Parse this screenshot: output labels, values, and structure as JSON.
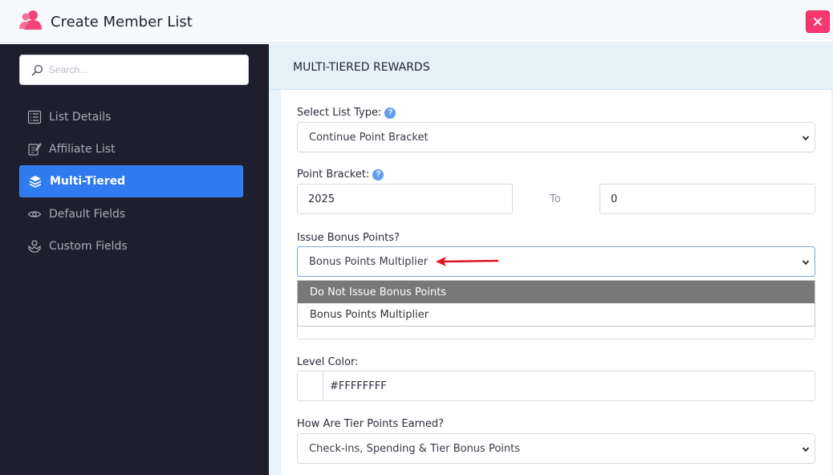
{
  "header": {
    "title": "Create Member List",
    "icon": "users-icon",
    "close_icon": "close-icon",
    "close_color": "#f7386e"
  },
  "sidebar": {
    "search_placeholder": "Search...",
    "items": [
      {
        "label": "List Details",
        "icon": "list-details-icon",
        "active": false
      },
      {
        "label": "Affiliate List",
        "icon": "affiliate-icon",
        "active": false
      },
      {
        "label": "Multi-Tiered",
        "icon": "layers-icon",
        "active": true
      },
      {
        "label": "Default Fields",
        "icon": "eye-icon",
        "active": false
      },
      {
        "label": "Custom Fields",
        "icon": "custom-fields-icon",
        "active": false
      }
    ],
    "active_color": "#2f7bef"
  },
  "main": {
    "section_title": "MULTI-TIERED REWARDS",
    "list_type": {
      "label": "Select List Type:",
      "value": "Continue Point Bracket",
      "help": "?"
    },
    "point_bracket": {
      "label": "Point Bracket:",
      "help": "?",
      "from": "2025",
      "to_label": "To",
      "to": "0"
    },
    "bonus_points": {
      "label": "Issue Bonus Points?",
      "value": "Bonus Points Multiplier",
      "options": [
        "Do Not Issue Bonus Points",
        "Bonus Points Multiplier"
      ],
      "hovered_option": "Do Not Issue Bonus Points"
    },
    "level_color": {
      "label": "Level Color:",
      "value": "#FFFFFFFF"
    },
    "tier_points": {
      "label": "How Are Tier Points Earned?",
      "value": "Check-ins, Spending & Tier Bonus Points"
    },
    "annotation_color": "#e0141e"
  }
}
